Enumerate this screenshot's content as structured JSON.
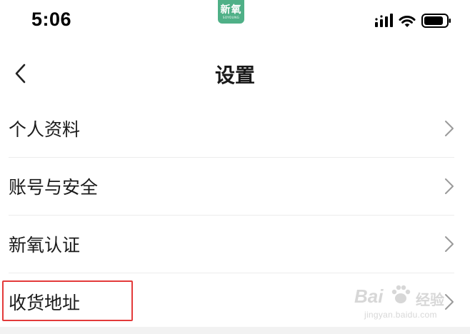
{
  "status_bar": {
    "time": "5:06",
    "app_logo_text": "新氧",
    "app_logo_subtext": "SOYOUNG",
    "icons": [
      "cellular-signal-icon",
      "wifi-icon",
      "battery-icon"
    ]
  },
  "nav": {
    "title": "设置",
    "back_icon": "chevron-left-icon"
  },
  "menu": {
    "items": [
      {
        "label": "个人资料"
      },
      {
        "label": "账号与安全"
      },
      {
        "label": "新氧认证"
      },
      {
        "label": "收货地址",
        "highlighted": true
      }
    ],
    "chevron_icon": "chevron-right-icon"
  },
  "watermark": {
    "brand": "Bai",
    "brand_2": "经验",
    "url": "jingyan.baidu.com"
  },
  "colors": {
    "logo_green": "#4fb087",
    "highlight_red": "#e33a3a",
    "divider": "#ececec"
  }
}
